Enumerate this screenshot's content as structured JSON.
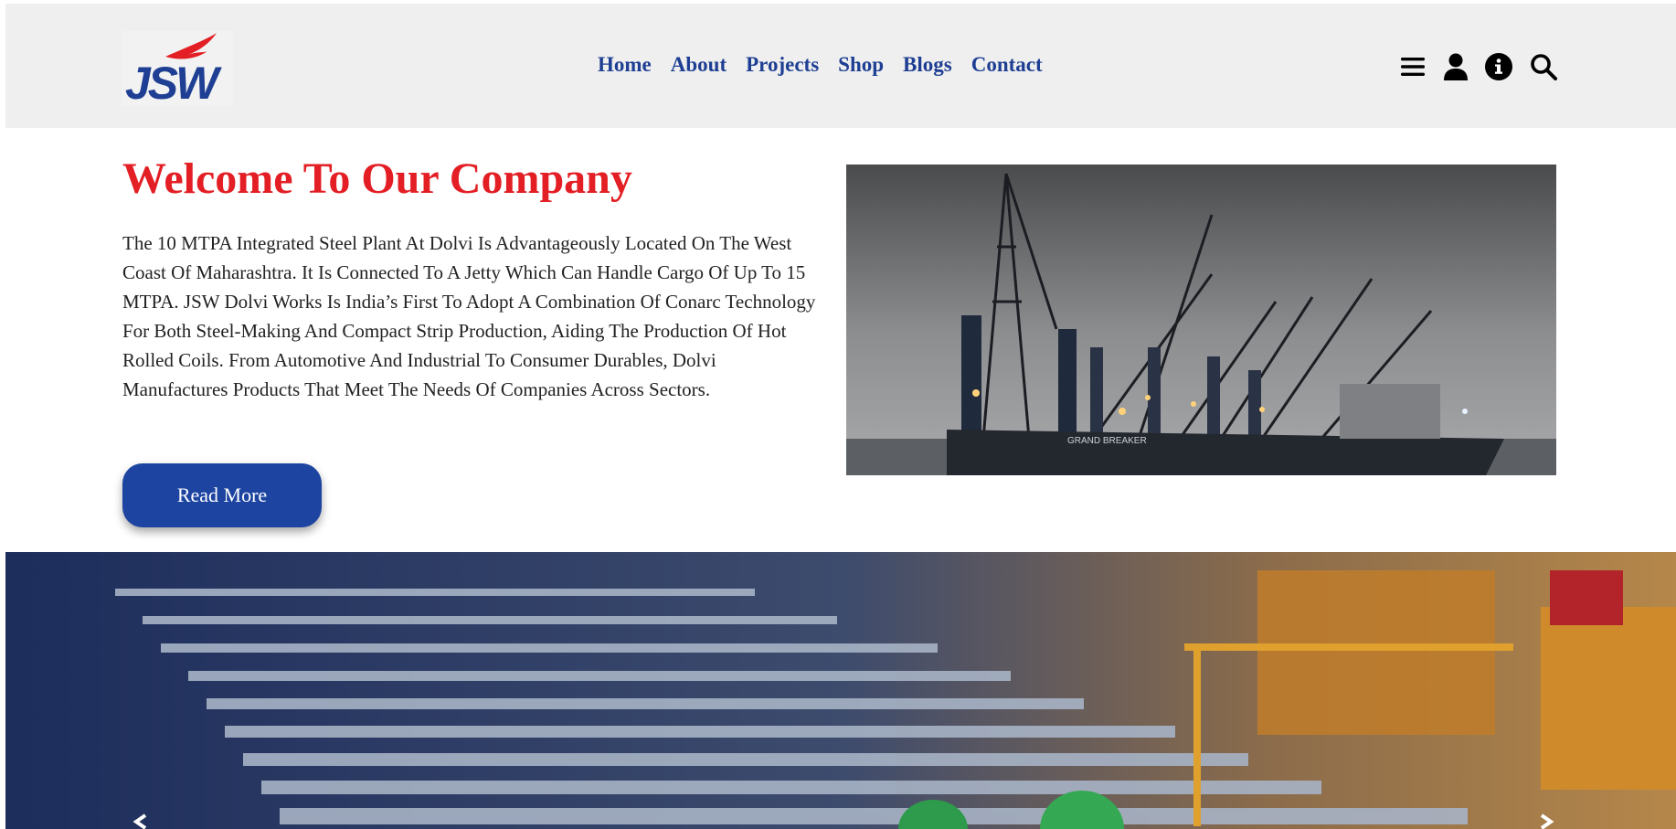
{
  "header": {
    "logo_text": "JSW",
    "nav": [
      {
        "label": "Home"
      },
      {
        "label": "About"
      },
      {
        "label": "Projects"
      },
      {
        "label": "Shop"
      },
      {
        "label": "Blogs"
      },
      {
        "label": "Contact"
      }
    ],
    "icons": [
      "menu-icon",
      "user-icon",
      "info-icon",
      "search-icon"
    ]
  },
  "welcome": {
    "title": "Welcome To Our Company",
    "body": "The 10 MTPA Integrated Steel Plant At Dolvi Is Advantageously Located On The West Coast Of Maharashtra. It Is Connected To A Jetty Which Can Handle Cargo Of Up To 15 MTPA. JSW Dolvi Works Is India’s First To Adopt A Combination Of Conarc Technology For Both Steel-Making And Compact Strip Production, Aiding The Production Of Hot Rolled Coils. From Automotive And Industrial To Consumer Durables, Dolvi Manufactures Products That Meet The Needs Of Companies Across Sectors.",
    "button_label": "Read More",
    "ship_label": "GRAND BREAKER"
  },
  "colors": {
    "brand_blue": "#1e3f93",
    "accent_red": "#e31e24",
    "button_blue": "#1c44a0",
    "header_bg": "#efefef"
  }
}
